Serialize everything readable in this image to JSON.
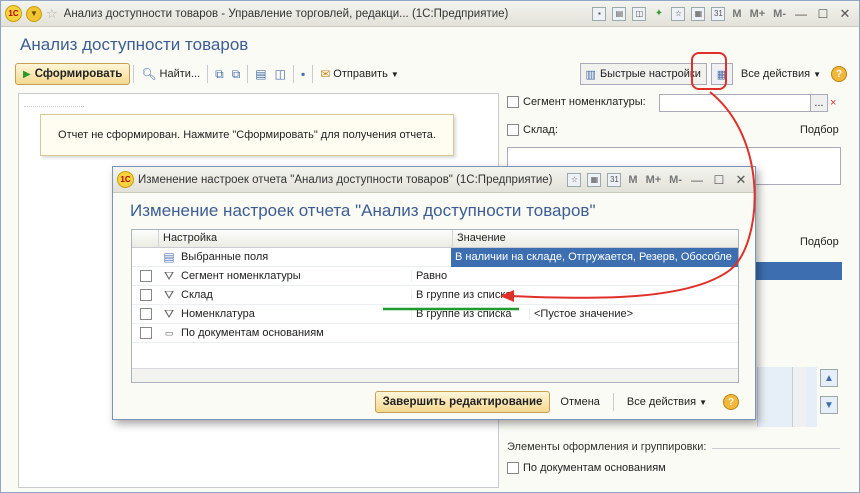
{
  "main_window": {
    "title": "Анализ доступности товаров - Управление торговлей, редакци... (1С:Предприятие)",
    "icons": {
      "logo": "1c-logo-icon",
      "menu": "menu-circle-icon",
      "favorite": "star-icon"
    },
    "title_buttons": [
      "M",
      "M+",
      "M-"
    ]
  },
  "page_title": "Анализ доступности товаров",
  "toolbar": {
    "generate_label": "Сформировать",
    "find_label": "Найти...",
    "send_label": "Отправить",
    "quick_settings_label": "Быстрые настройки",
    "all_actions_label": "Все действия",
    "help": "?"
  },
  "report": {
    "notice": "Отчет не сформирован. Нажмите \"Сформировать\" для получения отчета."
  },
  "right_panel": {
    "segment_label": "Сегмент номенклатуры:",
    "segment_dots": "...",
    "segment_clear": "×",
    "warehouse_label": "Склад:",
    "pick_label_1": "Подбор",
    "pick_label_2": "Подбор",
    "group_label": "Элементы оформления и группировки:",
    "by_docs_label": "По документам основаниям"
  },
  "dialog": {
    "title": "Изменение настроек отчета \"Анализ доступности товаров\" (1С:Предприятие)",
    "title_buttons": [
      "M",
      "M+",
      "M-"
    ],
    "heading": "Изменение настроек отчета \"Анализ доступности товаров\"",
    "columns": {
      "setting": "Настройка",
      "value": "Значение"
    },
    "rows": [
      {
        "name": "Выбранные поля",
        "value": "В наличии на складе, Отгружается, Резерв, Обособле"
      },
      {
        "name": "Сегмент номенклатуры",
        "comparison": "Равно",
        "value": ""
      },
      {
        "name": "Склад",
        "comparison": "В группе из списка",
        "value": ""
      },
      {
        "name": "Номенклатура",
        "comparison": "В группе из списка",
        "value": "<Пустое значение>"
      },
      {
        "name": "По документам основаниям",
        "comparison": "",
        "value": ""
      }
    ],
    "finish_label": "Завершить редактирование",
    "cancel_label": "Отмена",
    "all_actions_label": "Все действия",
    "help": "?"
  },
  "annotation_colors": {
    "arrow": "#e0302a",
    "underline": "#1e9a2e"
  }
}
